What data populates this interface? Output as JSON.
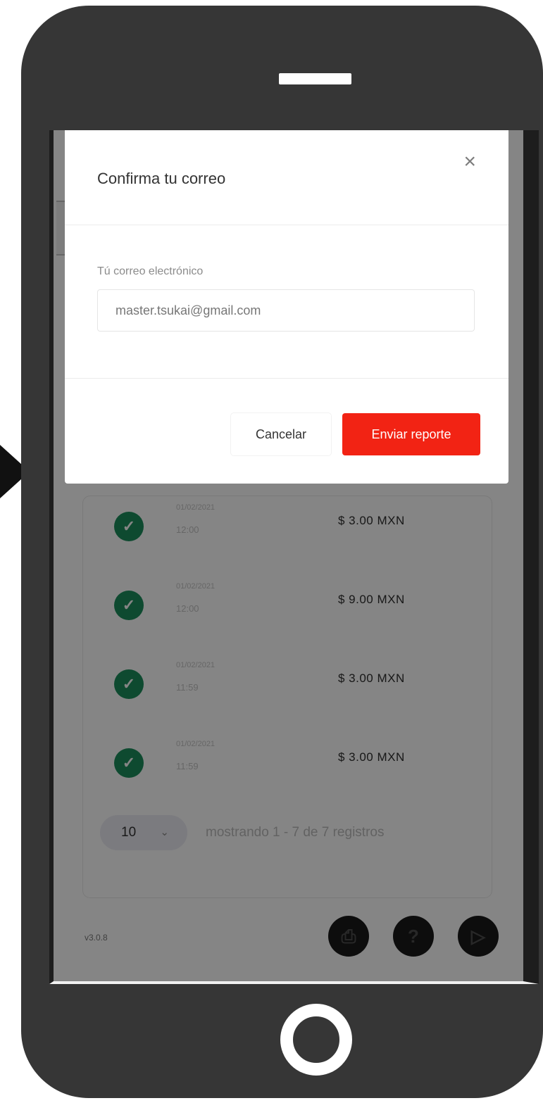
{
  "modal": {
    "title": "Confirma tu correo",
    "close_icon": "×",
    "email_label": "Tú correo electrónico",
    "email_value": "master.tsukai@gmail.com",
    "cancel_label": "Cancelar",
    "submit_label": "Enviar reporte",
    "submit_color": "#f22314"
  },
  "transactions": [
    {
      "date": "01/02/2021",
      "time": "12:00",
      "amount": "$ 3.00 MXN",
      "status_icon": "check-circle-icon"
    },
    {
      "date": "01/02/2021",
      "time": "12:00",
      "amount": "$ 9.00 MXN",
      "status_icon": "check-circle-icon"
    },
    {
      "date": "01/02/2021",
      "time": "11:59",
      "amount": "$ 3.00 MXN",
      "status_icon": "check-circle-icon"
    },
    {
      "date": "01/02/2021",
      "time": "11:59",
      "amount": "$ 3.00 MXN",
      "status_icon": "check-circle-icon"
    }
  ],
  "pagination": {
    "page_size": "10",
    "info": "mostrando 1 - 7 de 7 registros"
  },
  "footer": {
    "version": "v3.0.8",
    "fab_icons": [
      "print-icon",
      "help-icon",
      "play-icon"
    ]
  },
  "colors": {
    "success": "#1c8f5c",
    "phone_body": "#363636",
    "accent": "#f22314"
  }
}
